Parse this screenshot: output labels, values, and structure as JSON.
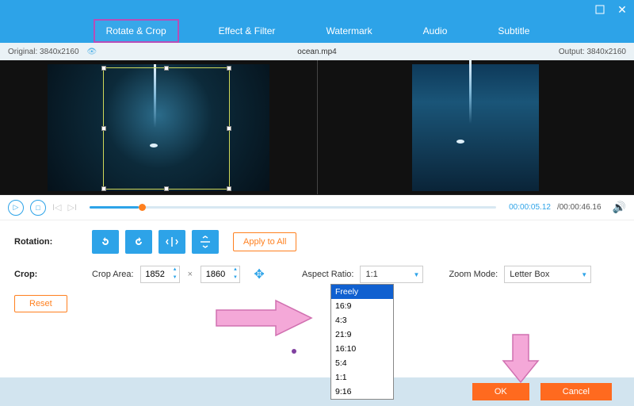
{
  "window": {
    "minimize": "—",
    "close": "✕"
  },
  "tabs": {
    "rotate_crop": "Rotate & Crop",
    "effect_filter": "Effect & Filter",
    "watermark": "Watermark",
    "audio": "Audio",
    "subtitle": "Subtitle"
  },
  "filebar": {
    "original_label": "Original:",
    "original_res": "3840x2160",
    "filename": "ocean.mp4",
    "output_label": "Output:",
    "output_res": "3840x2160"
  },
  "player": {
    "current_time": "00:00:05.12",
    "total_time": "/00:00:46.16"
  },
  "rotation": {
    "label": "Rotation:",
    "apply_all": "Apply to All"
  },
  "crop": {
    "label": "Crop:",
    "area_label": "Crop Area:",
    "width": "1852",
    "x": "×",
    "height": "1860",
    "aspect_label": "Aspect Ratio:",
    "aspect_value": "1:1",
    "zoom_label": "Zoom Mode:",
    "zoom_value": "Letter Box",
    "reset": "Reset"
  },
  "aspect_options": [
    "Freely",
    "16:9",
    "4:3",
    "21:9",
    "16:10",
    "5:4",
    "1:1",
    "9:16"
  ],
  "aspect_selected": "Freely",
  "footer": {
    "ok": "OK",
    "cancel": "Cancel"
  }
}
